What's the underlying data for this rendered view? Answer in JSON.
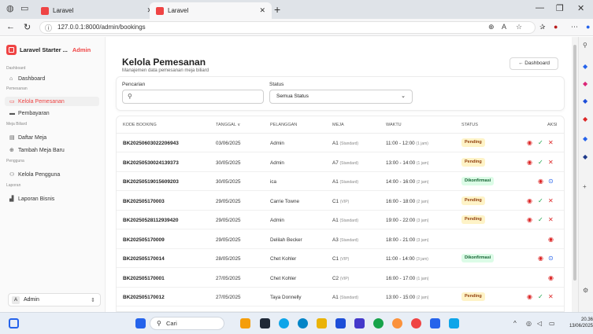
{
  "browser": {
    "tabs": [
      {
        "label": "Laravel",
        "active": false
      },
      {
        "label": "Laravel",
        "active": true
      }
    ],
    "url": "127.0.0.1:8000/admin/bookings"
  },
  "sidebar": {
    "brand": "Laravel Starter ...",
    "brand_badge": "Admin",
    "groups": {
      "dashboard": "Dashboard",
      "pemesanan": "Pemesanan",
      "meja": "Meja Biliard",
      "pengguna": "Pengguna",
      "laporan": "Laporan"
    },
    "items": {
      "dashboard": "Dashboard",
      "kelola_pemesanan": "Kelola Pemesanan",
      "pembayaran": "Pembayaran",
      "daftar_meja": "Daftar Meja",
      "tambah_meja": "Tambah Meja Baru",
      "kelola_pengguna": "Kelola Pengguna",
      "laporan_bisnis": "Laporan Bisnis"
    },
    "user": {
      "initial": "A",
      "name": "Admin"
    }
  },
  "page": {
    "title": "Kelola Pemesanan",
    "subtitle": "Manajemen data pemesanan meja biliard",
    "back_button": "← Dashboard",
    "search_label": "Pencarian",
    "search_placeholder": "",
    "status_label": "Status",
    "status_value": "Semua Status"
  },
  "table": {
    "headers": {
      "kode": "KODE BOOKING",
      "tanggal": "TANGGAL ∨",
      "pelanggan": "PELANGGAN",
      "meja": "MEJA",
      "waktu": "WAKTU",
      "status": "STATUS",
      "aksi": "AKSI"
    },
    "rows": [
      {
        "kode": "BK20250603022206943",
        "tanggal": "03/06/2025",
        "pelanggan": "Admin",
        "meja": "A1",
        "tipe": "(Standard)",
        "waktu": "11:00 - 12:00",
        "durasi": "(1 jam)",
        "status": "Pending"
      },
      {
        "kode": "BK20250530024139373",
        "tanggal": "30/05/2025",
        "pelanggan": "Admin",
        "meja": "A7",
        "tipe": "(Standard)",
        "waktu": "13:00 - 14:00",
        "durasi": "(1 jam)",
        "status": "Pending"
      },
      {
        "kode": "BK20250519015609203",
        "tanggal": "30/05/2025",
        "pelanggan": "ica",
        "meja": "A1",
        "tipe": "(Standard)",
        "waktu": "14:00 - 16:00",
        "durasi": "(2 jam)",
        "status": "Dikonfirmasi"
      },
      {
        "kode": "BK202505170003",
        "tanggal": "29/05/2025",
        "pelanggan": "Carrie Towne",
        "meja": "C1",
        "tipe": "(VIP)",
        "waktu": "16:00 - 18:00",
        "durasi": "(2 jam)",
        "status": "Pending"
      },
      {
        "kode": "BK20250528112939420",
        "tanggal": "29/05/2025",
        "pelanggan": "Admin",
        "meja": "A1",
        "tipe": "(Standard)",
        "waktu": "19:00 - 22:00",
        "durasi": "(3 jam)",
        "status": "Pending"
      },
      {
        "kode": "BK202505170009",
        "tanggal": "29/05/2025",
        "pelanggan": "Delilah Becker",
        "meja": "A3",
        "tipe": "(Standard)",
        "waktu": "18:00 - 21:00",
        "durasi": "(3 jam)",
        "status": ""
      },
      {
        "kode": "BK202505170014",
        "tanggal": "28/05/2025",
        "pelanggan": "Chet Kohler",
        "meja": "C1",
        "tipe": "(VIP)",
        "waktu": "11:00 - 14:00",
        "durasi": "(3 jam)",
        "status": "Dikonfirmasi"
      },
      {
        "kode": "BK202505170001",
        "tanggal": "27/05/2025",
        "pelanggan": "Chet Kohler",
        "meja": "C2",
        "tipe": "(VIP)",
        "waktu": "16:00 - 17:00",
        "durasi": "(1 jam)",
        "status": ""
      },
      {
        "kode": "BK202505170012",
        "tanggal": "27/05/2025",
        "pelanggan": "Taya Donnelly",
        "meja": "A1",
        "tipe": "(Standard)",
        "waktu": "13:00 - 15:00",
        "durasi": "(2 jam)",
        "status": "Pending"
      }
    ]
  },
  "taskbar": {
    "search": "Cari",
    "time": "20.36",
    "date": "13/06/2025"
  },
  "colors": {
    "accent": "#ef4444",
    "pending_bg": "#fef3c7",
    "confirmed_bg": "#dcfce7"
  }
}
